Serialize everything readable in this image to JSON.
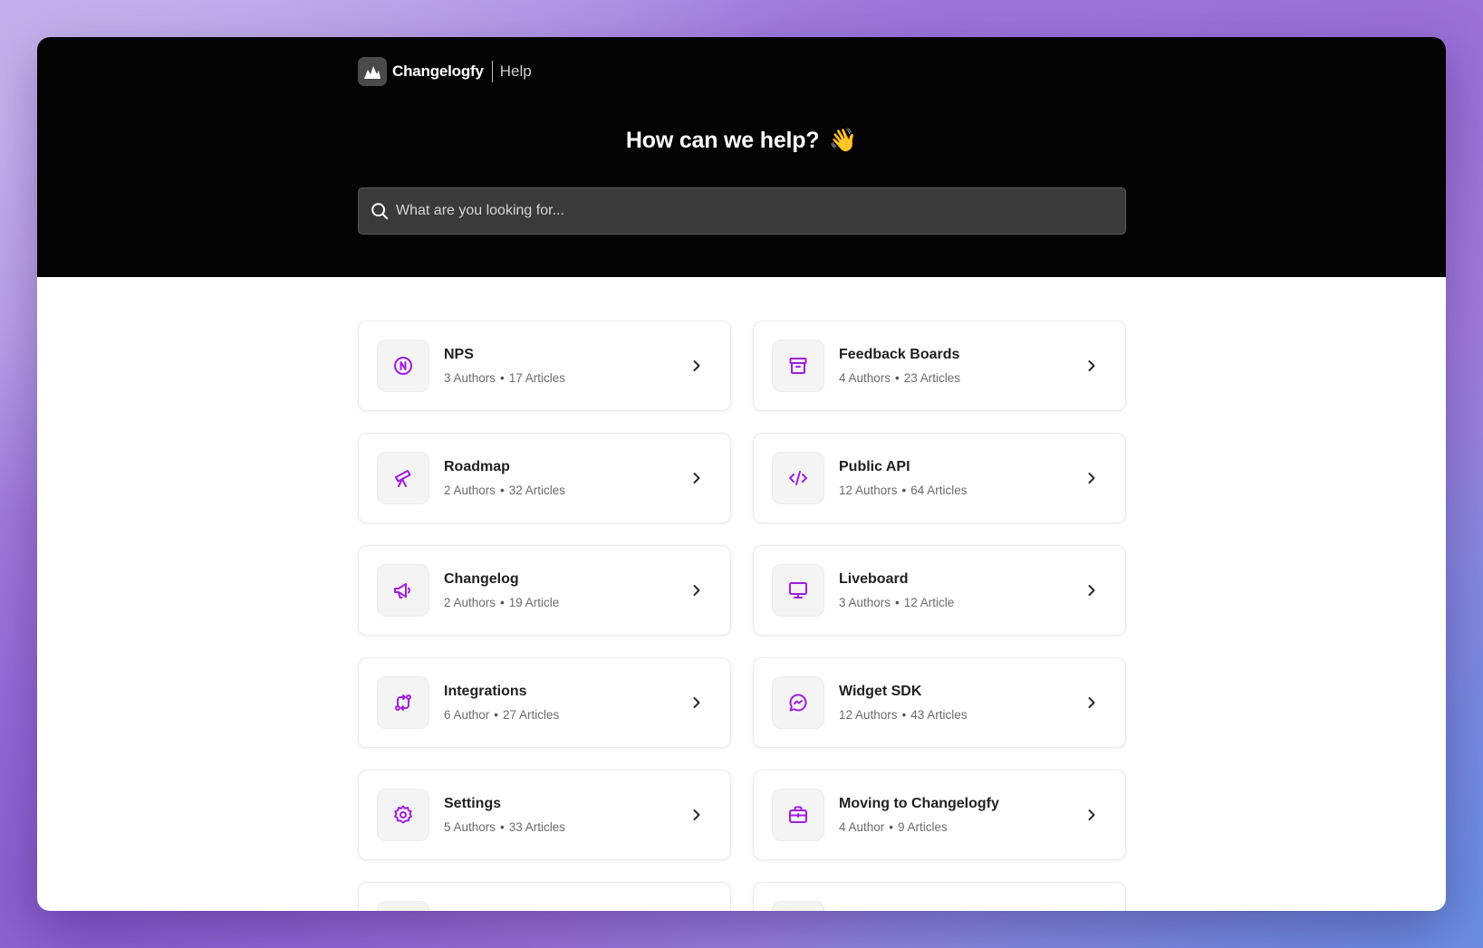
{
  "brand": {
    "name": "Changelogfy",
    "section": "Help"
  },
  "hero": {
    "title": "How can we help?",
    "emoji": "👋"
  },
  "search": {
    "placeholder": "What are you looking for..."
  },
  "colors": {
    "accent": "#a21ce0",
    "hero_bg": "#030303"
  },
  "categories": [
    {
      "title": "NPS",
      "authors": "3 Authors",
      "articles": "17 Articles",
      "icon": "nps-icon"
    },
    {
      "title": "Feedback Boards",
      "authors": "4 Authors",
      "articles": "23 Articles",
      "icon": "archive-icon"
    },
    {
      "title": "Roadmap",
      "authors": "2 Authors",
      "articles": "32 Articles",
      "icon": "telescope-icon"
    },
    {
      "title": "Public API",
      "authors": "12 Authors",
      "articles": "64 Articles",
      "icon": "code-icon"
    },
    {
      "title": "Changelog",
      "authors": "2 Authors",
      "articles": "19 Article",
      "icon": "megaphone-icon"
    },
    {
      "title": "Liveboard",
      "authors": "3 Authors",
      "articles": "12 Article",
      "icon": "monitor-icon"
    },
    {
      "title": "Integrations",
      "authors": "6 Author",
      "articles": "27 Articles",
      "icon": "swap-icon"
    },
    {
      "title": "Widget SDK",
      "authors": "12 Authors",
      "articles": "43 Articles",
      "icon": "message-icon"
    },
    {
      "title": "Settings",
      "authors": "5 Authors",
      "articles": "33 Articles",
      "icon": "gear-icon"
    },
    {
      "title": "Moving to Changelogfy",
      "authors": "4 Author",
      "articles": "9 Articles",
      "icon": "briefcase-icon"
    },
    {
      "title": "",
      "authors": "",
      "articles": "",
      "icon": ""
    },
    {
      "title": "",
      "authors": "",
      "articles": "",
      "icon": ""
    }
  ],
  "meta_separator": "•"
}
